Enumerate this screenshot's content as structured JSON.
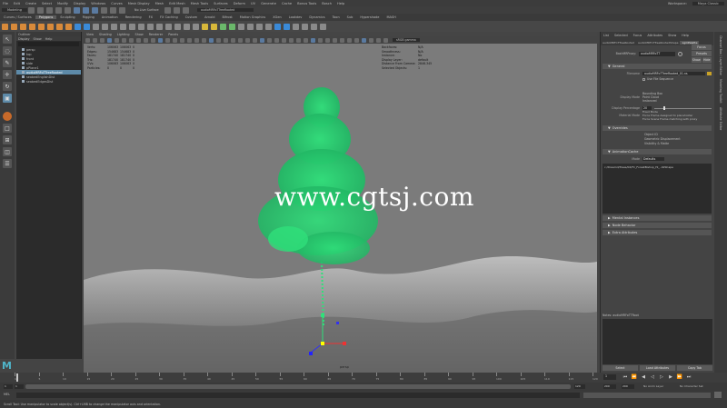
{
  "menubar": {
    "items": [
      "File",
      "Edit",
      "Create",
      "Select",
      "Modify",
      "Display",
      "Windows",
      "Curves",
      "Mesh Display",
      "Mesh",
      "Edit Mesh",
      "Mesh Tools",
      "Surfaces",
      "Deform",
      "UV",
      "Generate",
      "Cache",
      "Bonus Tools",
      "Bosch",
      "Help"
    ],
    "workspace_label": "Workspace:",
    "workspace_value": "Maya Classic"
  },
  "statusline": {
    "mode": "Modeling",
    "live_surface": "No Live Surface",
    "name_field": "audioMRFoTTreeRooted"
  },
  "shelf_tabs": [
    "Curves / Surfaces",
    "Polygons",
    "Sculpting",
    "Rigging",
    "Animation",
    "Rendering",
    "FX",
    "FX Caching",
    "Custom",
    "Arnold",
    "Bifrost",
    "Motion Graphics",
    "XGen",
    "Lookdev",
    "Dynamics",
    "Toon",
    "Sub",
    "Hypershade",
    "MASH"
  ],
  "shelf_active": "Polygons",
  "outliner": {
    "title": "Outliner",
    "menus": [
      "Display",
      "Show",
      "Help"
    ],
    "items": [
      "persp",
      "top",
      "front",
      "side",
      "pPlane1",
      "audioMRFoTTreeRooted",
      "seabedEnglishDist",
      "seabedEdgesDist"
    ],
    "selected": "audioMRFoTTreeRooted"
  },
  "viewport": {
    "menus": [
      "View",
      "Shading",
      "Lighting",
      "Show",
      "Renderer",
      "Panels"
    ],
    "colorspace": "sRGB gamma",
    "camera": "persp",
    "hud_left": {
      "headers": [
        "",
        "",
        "",
        ""
      ],
      "rows": [
        [
          "Verts:",
          "106063",
          "106063",
          "0"
        ],
        [
          "Edges:",
          "154683",
          "154683",
          "0"
        ],
        [
          "Faces:",
          "181740",
          "181740",
          "0"
        ],
        [
          "Tris:",
          "181740",
          "181740",
          "0"
        ],
        [
          "UVs:",
          "106063",
          "106063",
          "0"
        ],
        [
          "Particles:",
          "0",
          "0",
          "0"
        ]
      ]
    },
    "hud_right": {
      "rows": [
        [
          "Backfaces:",
          "N/A"
        ],
        [
          "Smoothness:",
          "N/A"
        ],
        [
          "Instance:",
          "No"
        ],
        [
          "Display Layer:",
          "default"
        ],
        [
          "Distance From Camera:",
          "2846.345"
        ],
        [
          "Selected Objects:",
          "1"
        ]
      ]
    },
    "watermark": "www.cgtsj.com"
  },
  "attribute_editor": {
    "tabs": [
      "List",
      "Selected",
      "Focus",
      "Attributes",
      "Show",
      "Help"
    ],
    "node_tabs": [
      "audioMRFoTTreeRooted",
      "audioMRFoTTreeRootedShape",
      "xgmPalette"
    ],
    "node_type_label": "BashMRProxy:",
    "node_name": "audioMRFoTT",
    "focus_btn": "Focus",
    "presets_btn": "Presets",
    "show_btn": "Show",
    "hide_btn": "Hide",
    "sections": {
      "general": "General",
      "overrides": "Overrides",
      "animation": "AnimationCache",
      "mental": "Mental Instances",
      "node": "Node Behavior",
      "extra": "Extra Attributes"
    },
    "fields": {
      "filename_label": "Filename",
      "filename_value": "audioMRFoTTreeRooted_01.ns",
      "use_file": "Use File Sequence",
      "display_mode_label": "Display Mode",
      "display_mode_options": [
        "Bounding Box",
        "Point Cloud",
        "Instanced"
      ],
      "display_percent_label": "Display Percentage",
      "display_percent_value": "20",
      "material_label": "Material Mode",
      "material_options": [
        "Fixed Mode",
        "Force Frame Assigned to placeholder",
        "Force Scene Frame matching with proxy"
      ],
      "override_options": [
        "Object ID",
        "Geometric Displacement",
        "Visibility & Matte"
      ],
      "cache_label": "Mode",
      "cache_value": "Defaults",
      "cache_path": "c:/Dreamd/Trees/02/Fir_ForestBishop_Hi_..02Shape"
    },
    "notes_label": "Notes: audioMRFoTTRoot",
    "bottom_buttons": [
      "Select",
      "Load Attributes",
      "Copy Tab"
    ]
  },
  "right_strip": [
    "Channel Box / Layer Editor",
    "Modeling Toolkit",
    "Attribute Editor"
  ],
  "timeslider": {
    "ticks": [
      "1",
      "5",
      "10",
      "15",
      "20",
      "25",
      "30",
      "35",
      "40",
      "45",
      "50",
      "55",
      "60",
      "65",
      "70",
      "75",
      "80",
      "85",
      "90",
      "95",
      "100",
      "105",
      "110",
      "115",
      "120"
    ],
    "current": "1"
  },
  "rangeslider": {
    "start": "1",
    "inner_start": "1",
    "inner_end": "120",
    "end": "200",
    "end2": "200",
    "anim_layer": "No Anim Layer",
    "char_set": "No Character Set"
  },
  "cmdline": {
    "lang": "MEL"
  },
  "helpline": {
    "text": "Scroll Tool: Use manipulator to scale object(s). Ctrl+LMB to change the manipulator axis and orientation."
  },
  "colors": {
    "viewport_bg": "#7b7b7b",
    "tree": "#2fe07a",
    "selected": "#5d8aa8"
  }
}
